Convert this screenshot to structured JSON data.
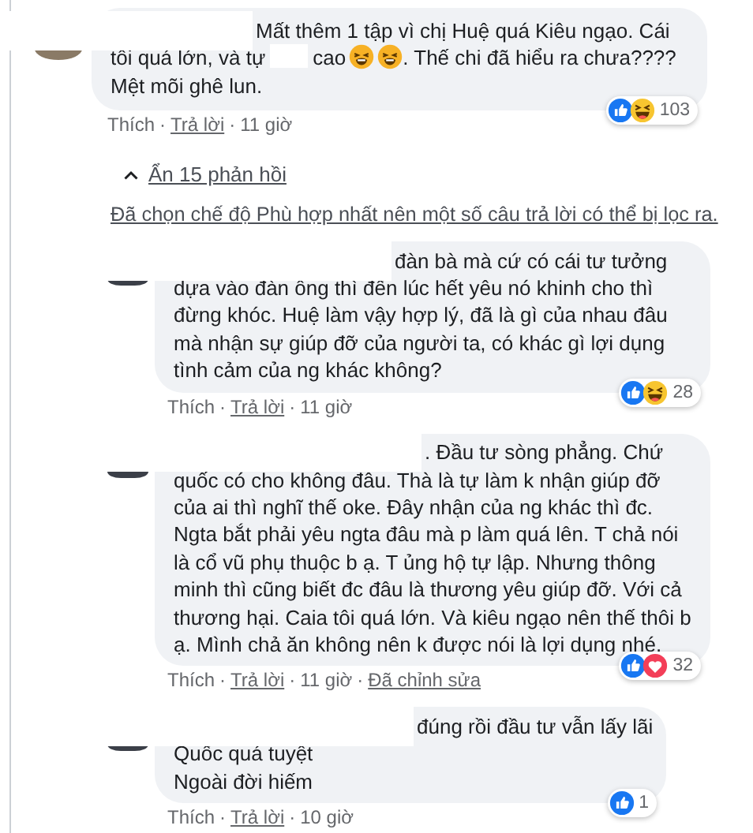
{
  "comment": {
    "first_line": "Mất thêm 1 tập vì chị Huệ quá Kiêu ngạo. Cái",
    "body": [
      {
        "kind": "text",
        "text": "tôi quá lớn, và tự"
      },
      {
        "kind": "redacted"
      },
      {
        "kind": "text",
        "text": "cao"
      },
      {
        "kind": "emoji"
      },
      {
        "kind": "emoji"
      },
      {
        "kind": "text",
        "text": ". Thế chi đã hiểu ra chưa????"
      },
      {
        "kind": "line",
        "text": "Mệt mõi ghê lun."
      }
    ],
    "reactions": {
      "icons": [
        {
          "kind": "like"
        },
        {
          "kind": "haha"
        }
      ],
      "count": "103"
    },
    "meta": [
      {
        "kind": "plain",
        "text": "Thích"
      },
      {
        "kind": "sep",
        "text": "·"
      },
      {
        "kind": "link",
        "text": "Trả lời"
      },
      {
        "kind": "sep",
        "text": "·"
      },
      {
        "kind": "plain",
        "text": "11 giờ"
      }
    ]
  },
  "replies_toggle": {
    "label": "Ẩn 15 phản hồi",
    "expanded": true
  },
  "filter_notice": "Đã chọn chế độ Phù hợp nhất nên một số câu trả lời có thể bị lọc ra.",
  "replies": [
    {
      "first_line": "đàn bà mà cứ có cái tư tưởng",
      "body": [
        {
          "kind": "line",
          "text": "dựa vào đàn ông thì đến lúc hết yêu nó khinh cho thì đừng khóc. Huệ làm vậy hợp lý, đã là gì của nhau đâu mà nhận sự giúp đỡ của người ta, có khác gì lợi dụng tình cảm của ng khác không?"
        }
      ],
      "reactions": {
        "icons": [
          {
            "kind": "like"
          },
          {
            "kind": "haha"
          }
        ],
        "count": "28"
      },
      "meta": [
        {
          "kind": "plain",
          "text": "Thích"
        },
        {
          "kind": "sep",
          "text": "·"
        },
        {
          "kind": "link",
          "text": "Trả lời"
        },
        {
          "kind": "sep",
          "text": "·"
        },
        {
          "kind": "plain",
          "text": "11 giờ"
        }
      ]
    },
    {
      "first_line": ". Đầu tư sòng phẳng. Chứ",
      "body": [
        {
          "kind": "line",
          "text": "quốc có cho không đâu. Thà là tự làm k nhận giúp đỡ của ai thì nghĩ thế oke. Đây nhận của ng khác thì đc. Ngta bắt phải yêu ngta đâu mà p làm quá lên. T chả nói là cổ vũ phụ thuộc b ạ. T ủng hộ tự lập. Nhưng thông minh thì cũng biết đc đâu là thương yêu giúp đỡ. Với cả thương hại. Caia tôi quá lớn. Và kiêu ngạo nên thế thôi b ạ. Mình chả ăn không nên k được nói là lợi dụng nhé."
        }
      ],
      "reactions": {
        "icons": [
          {
            "kind": "like"
          },
          {
            "kind": "heart"
          }
        ],
        "count": "32"
      },
      "meta": [
        {
          "kind": "plain",
          "text": "Thích"
        },
        {
          "kind": "sep",
          "text": "·"
        },
        {
          "kind": "link",
          "text": "Trả lời"
        },
        {
          "kind": "sep",
          "text": "·"
        },
        {
          "kind": "plain",
          "text": "11 giờ"
        },
        {
          "kind": "sep",
          "text": "·"
        },
        {
          "kind": "link",
          "text": "Đã chỉnh sửa"
        }
      ]
    },
    {
      "first_line": "đúng rồi đầu tư vẫn lấy lãi",
      "body": [
        {
          "kind": "line",
          "text": "Quốc quá tuyệt"
        },
        {
          "kind": "line",
          "text": "Ngoài đời hiếm"
        }
      ],
      "reactions": {
        "icons": [
          {
            "kind": "like"
          }
        ],
        "count": "1"
      },
      "meta": [
        {
          "kind": "plain",
          "text": "Thích"
        },
        {
          "kind": "sep",
          "text": "·"
        },
        {
          "kind": "link",
          "text": "Trả lời"
        },
        {
          "kind": "sep",
          "text": "·"
        },
        {
          "kind": "plain",
          "text": "10 giờ"
        }
      ]
    }
  ]
}
